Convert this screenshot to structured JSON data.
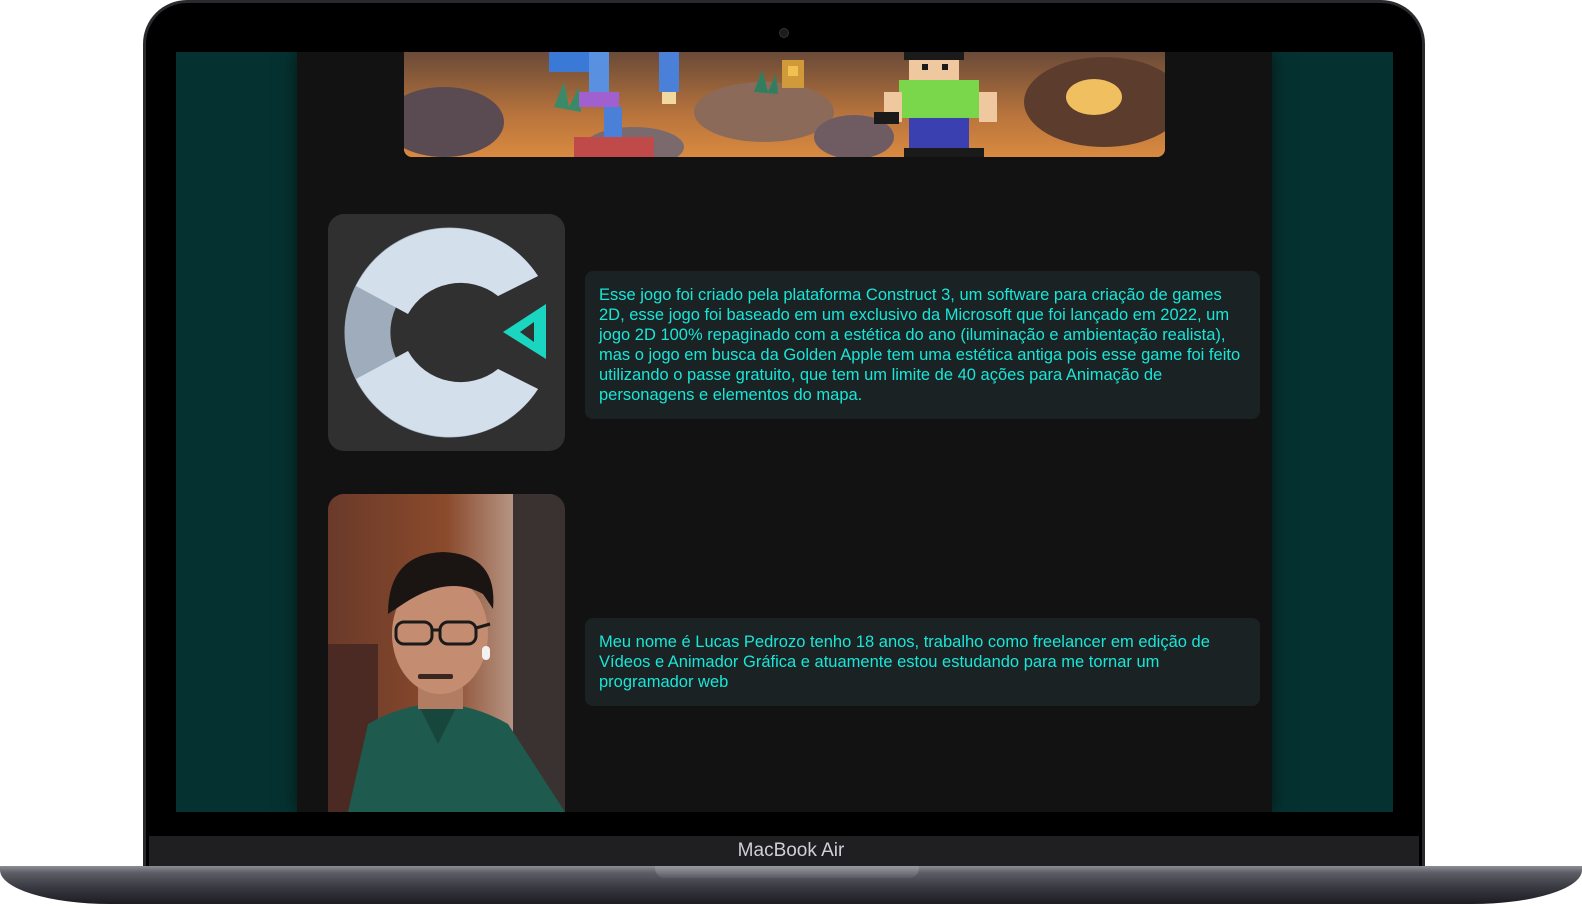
{
  "device": {
    "brand_label": "MacBook Air"
  },
  "page": {
    "banner": {
      "description_icon": "pixel-art-game-banner"
    },
    "sections": [
      {
        "image_icon": "construct3-logo-icon",
        "text": "Esse jogo foi criado pela plataforma Construct 3, um software para criação de games 2D, esse jogo foi baseado em um exclusivo da Microsoft que foi lançado em 2022, um jogo 2D 100% repaginado com a estética do ano (iluminação e ambientação realista), mas o jogo em busca da Golden Apple tem uma estética antiga pois esse game foi feito utilizando o passe gratuito, que tem um limite de 40 ações para Animação de personagens e elementos do mapa."
      },
      {
        "image_icon": "author-portrait-photo",
        "text": "Meu nome é Lucas Pedrozo tenho 18 anos, trabalho como freelancer em edição de Vídeos e Animador Gráfica e atuamente estou estudando para me tornar um programador web"
      }
    ]
  },
  "colors": {
    "page_background": "#053230",
    "content_background": "#121212",
    "text_card_background": "#1a2223",
    "text_color": "#19e6d8",
    "construct_accent": "#1ad6c0"
  }
}
